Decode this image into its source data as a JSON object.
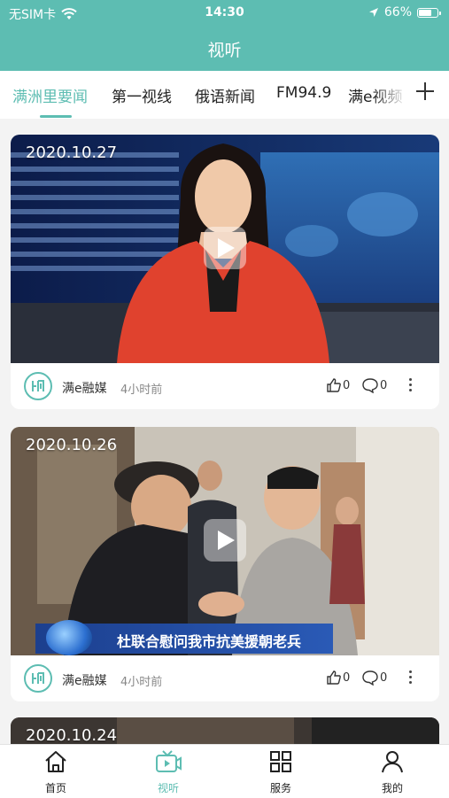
{
  "status_bar": {
    "carrier": "无SIM卡",
    "time": "14:30",
    "battery": "66%"
  },
  "header": {
    "title": "视听"
  },
  "tabs": [
    {
      "label": "满洲里要闻",
      "active": true
    },
    {
      "label": "第一视线"
    },
    {
      "label": "俄语新闻"
    },
    {
      "label": "FM94.9"
    },
    {
      "label": "满e视频"
    }
  ],
  "videos": [
    {
      "date": "2020.10.27",
      "source": "满e融媒",
      "time_ago": "4小时前",
      "likes": "0",
      "comments": "0"
    },
    {
      "date": "2020.10.26",
      "source": "满e融媒",
      "time_ago": "4小时前",
      "likes": "0",
      "comments": "0",
      "caption": "杜联合慰问我市抗美援朝老兵"
    },
    {
      "date": "2020.10.24"
    }
  ],
  "bottom_nav": [
    {
      "label": "首页"
    },
    {
      "label": "视听",
      "active": true
    },
    {
      "label": "服务"
    },
    {
      "label": "我的"
    }
  ],
  "colors": {
    "accent": "#5dbdb2"
  },
  "icons": [
    "wifi-icon",
    "location-arrow-icon",
    "battery-icon",
    "plus-icon",
    "play-icon",
    "thumb-up-icon",
    "comment-icon",
    "more-icon",
    "home-icon",
    "tv-icon",
    "grid-icon",
    "user-icon"
  ]
}
